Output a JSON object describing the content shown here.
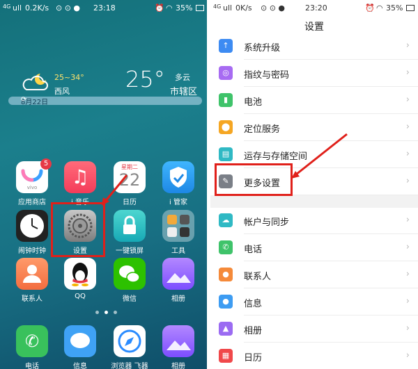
{
  "home": {
    "status": {
      "network": "4G",
      "signal": "ull",
      "speed": "0.2K/s",
      "time": "23:18",
      "battery": "35%"
    },
    "weather": {
      "range": "25~34°",
      "wind": "西风",
      "temp": "25°",
      "condition": "多云",
      "district": "市辖区",
      "date": "8月22日"
    },
    "calendar": {
      "weekday": "星期二",
      "day": "22"
    },
    "apps": [
      {
        "label": "应用商店",
        "badge": "5"
      },
      {
        "label": "i 音乐"
      },
      {
        "label": "日历"
      },
      {
        "label": "i 管家"
      },
      {
        "label": "闹钟时钟"
      },
      {
        "label": "设置"
      },
      {
        "label": "一键锁屏"
      },
      {
        "label": "工具"
      },
      {
        "label": "联系人"
      },
      {
        "label": "QQ"
      },
      {
        "label": "微信"
      },
      {
        "label": "相册"
      }
    ],
    "dock": [
      {
        "label": "电话"
      },
      {
        "label": "信息"
      },
      {
        "label": "浏览器 飞器"
      },
      {
        "label": "相册"
      }
    ],
    "app_brand_text": "vivo"
  },
  "settings": {
    "status": {
      "network": "4G",
      "signal": "ull",
      "speed": "0K/s",
      "time": "23:20",
      "battery": "35%"
    },
    "title": "设置",
    "group1": [
      {
        "label": "系统升级",
        "icon": "system-update-icon"
      },
      {
        "label": "指纹与密码",
        "icon": "fingerprint-icon"
      },
      {
        "label": "电池",
        "icon": "battery-icon"
      },
      {
        "label": "定位服务",
        "icon": "location-icon"
      },
      {
        "label": "运存与存储空间",
        "icon": "storage-icon"
      },
      {
        "label": "更多设置",
        "icon": "wrench-icon"
      }
    ],
    "group2": [
      {
        "label": "帐户与同步",
        "icon": "cloud-sync-icon"
      },
      {
        "label": "电话",
        "icon": "phone-icon"
      },
      {
        "label": "联系人",
        "icon": "contacts-icon"
      },
      {
        "label": "信息",
        "icon": "message-icon"
      },
      {
        "label": "相册",
        "icon": "album-icon"
      },
      {
        "label": "日历",
        "icon": "calendar-icon"
      }
    ],
    "chevron": "›"
  },
  "colors": {
    "highlight": "#e0201a",
    "accent_teal": "#1b7f8c"
  }
}
